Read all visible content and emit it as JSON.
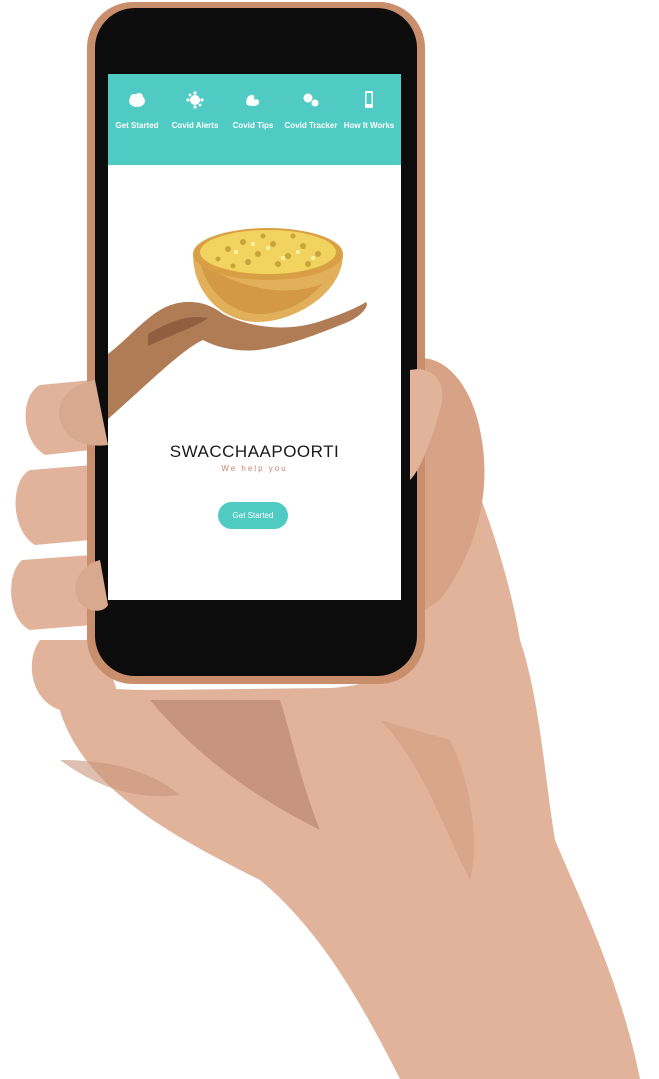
{
  "colors": {
    "accent": "#4fcbc3",
    "phone_frame": "#c98f6d",
    "skin_light": "#e2b39b",
    "skin_mid": "#d7a286",
    "skin_dark": "#b07c66",
    "bowl": "#e8b85a",
    "grain": "#f2d35f",
    "tagline": "#c6856b"
  },
  "nav": {
    "items": [
      {
        "label": "Get Started",
        "icon": "cloud-icon"
      },
      {
        "label": "Covid Alerts",
        "icon": "virus-icon"
      },
      {
        "label": "Covid Tips",
        "icon": "hands-icon"
      },
      {
        "label": "Covid Tracker",
        "icon": "bubbles-icon"
      },
      {
        "label": "How It Works",
        "icon": "phone-icon"
      }
    ]
  },
  "hero": {
    "brand": "SWACCHAAPOORTI",
    "tagline": "We help you",
    "illustration": "hand-holding-bowl-icon"
  },
  "cta": {
    "label": "Get Started"
  }
}
